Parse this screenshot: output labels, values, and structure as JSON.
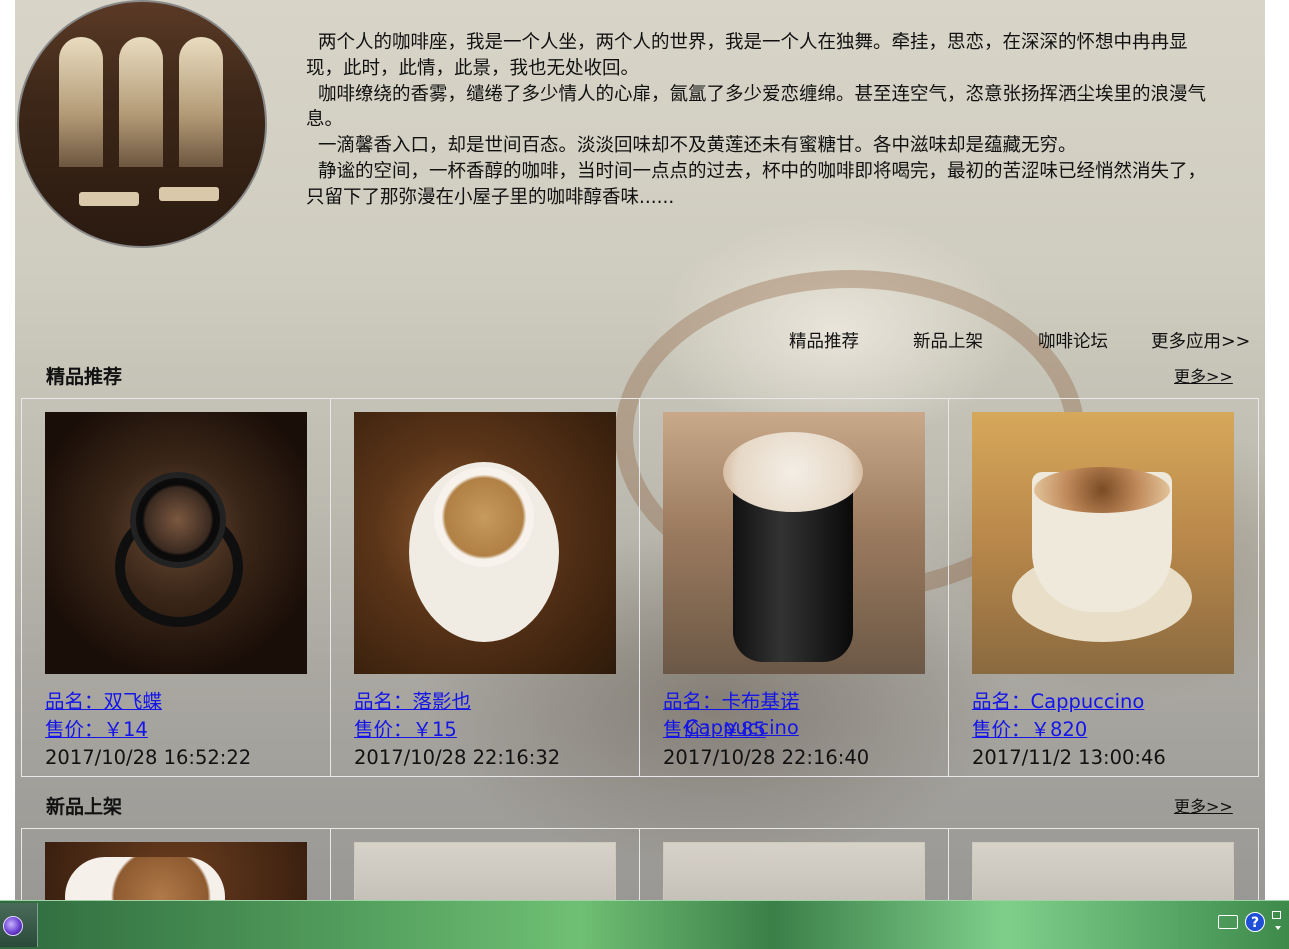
{
  "intro": {
    "paragraphs": [
      "两个人的咖啡座，我是一个人坐，两个人的世界，我是一个人在独舞。牵挂，思恋，在深深的怀想中冉冉显现，此时，此情，此景，我也无处收回。",
      "咖啡缭绕的香雾，缱绻了多少情人的心扉，氤氲了多少爱恋缠绵。甚至连空气，恣意张扬挥洒尘埃里的浪漫气息。",
      "一滴馨香入口，却是世间百态。淡淡回味却不及黄莲还未有蜜糖甘。各中滋味却是蕴藏无穷。",
      "静谧的空间，一杯香醇的咖啡，当时间一点点的过去，杯中的咖啡即将喝完，最初的苦涩味已经悄然消失了，只留下了那弥漫在小屋子里的咖啡醇香味......"
    ]
  },
  "nav": {
    "items": [
      "精品推荐",
      "新品上架",
      "咖啡论坛",
      "更多应用>>"
    ]
  },
  "featured": {
    "title": "精品推荐",
    "more": "更多>>",
    "products": [
      {
        "name": "品名：双飞蝶",
        "price": "售价：￥14",
        "date": "2017/10/28 16:52:22"
      },
      {
        "name": "品名：落影也",
        "price": "售价：￥15",
        "date": "2017/10/28 22:16:32"
      },
      {
        "name": "品名：卡布基诺",
        "price": "售价：￥85",
        "overlap": "Cappuccino",
        "date": "2017/10/28 22:16:40"
      },
      {
        "name": "品名：Cappuccino",
        "price": "售价：￥820",
        "date": "2017/11/2 13:00:46"
      }
    ]
  },
  "new_arrivals": {
    "title": "新品上架",
    "more": "更多>>"
  },
  "taskbar": {
    "help_label": "?",
    "keyboard_icon": "keyboard-icon",
    "restore_icon": "restore-icon"
  }
}
